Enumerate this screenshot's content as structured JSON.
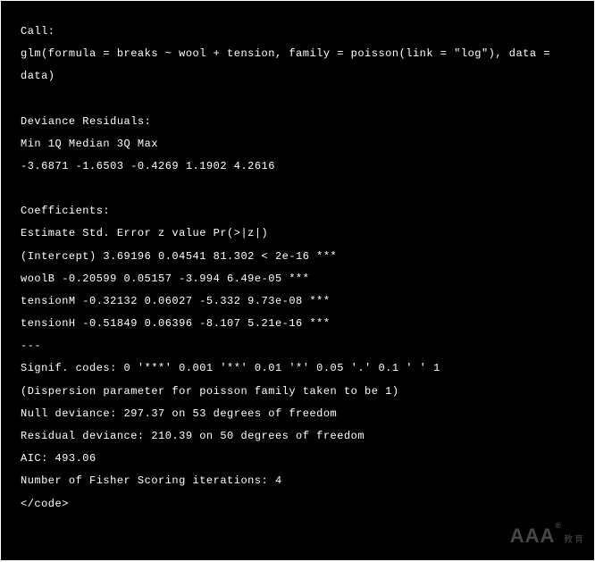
{
  "lines": {
    "l1": "Call:",
    "l2": "glm(formula = breaks ~ wool + tension, family = poisson(link = \"log\"), data = data)",
    "l3": "Deviance Residuals:",
    "l4": "Min 1Q Median 3Q Max",
    "l5": "-3.6871 -1.6503 -0.4269 1.1902 4.2616",
    "l6": "Coefficients:",
    "l7": "Estimate Std. Error z value Pr(>|z|)",
    "l8": "(Intercept) 3.69196 0.04541 81.302 < 2e-16 ***",
    "l9": "woolB -0.20599 0.05157 -3.994 6.49e-05 ***",
    "l10": "tensionM -0.32132 0.06027 -5.332 9.73e-08 ***",
    "l11": "tensionH -0.51849 0.06396 -8.107 5.21e-16 ***",
    "l12": "---",
    "l13": "Signif. codes: 0 '***' 0.001 '**' 0.01 '*' 0.05 '.' 0.1 ' ' 1",
    "l14": "(Dispersion parameter for poisson family taken to be 1)",
    "l15": "Null deviance: 297.37 on 53 degrees of freedom",
    "l16": "Residual deviance: 210.39 on 50 degrees of freedom",
    "l17": "AIC: 493.06",
    "l18": "Number of Fisher Scoring iterations: 4",
    "l19": "</code>"
  },
  "watermark": {
    "main": "AAA",
    "reg": "®",
    "sub": "教育"
  }
}
